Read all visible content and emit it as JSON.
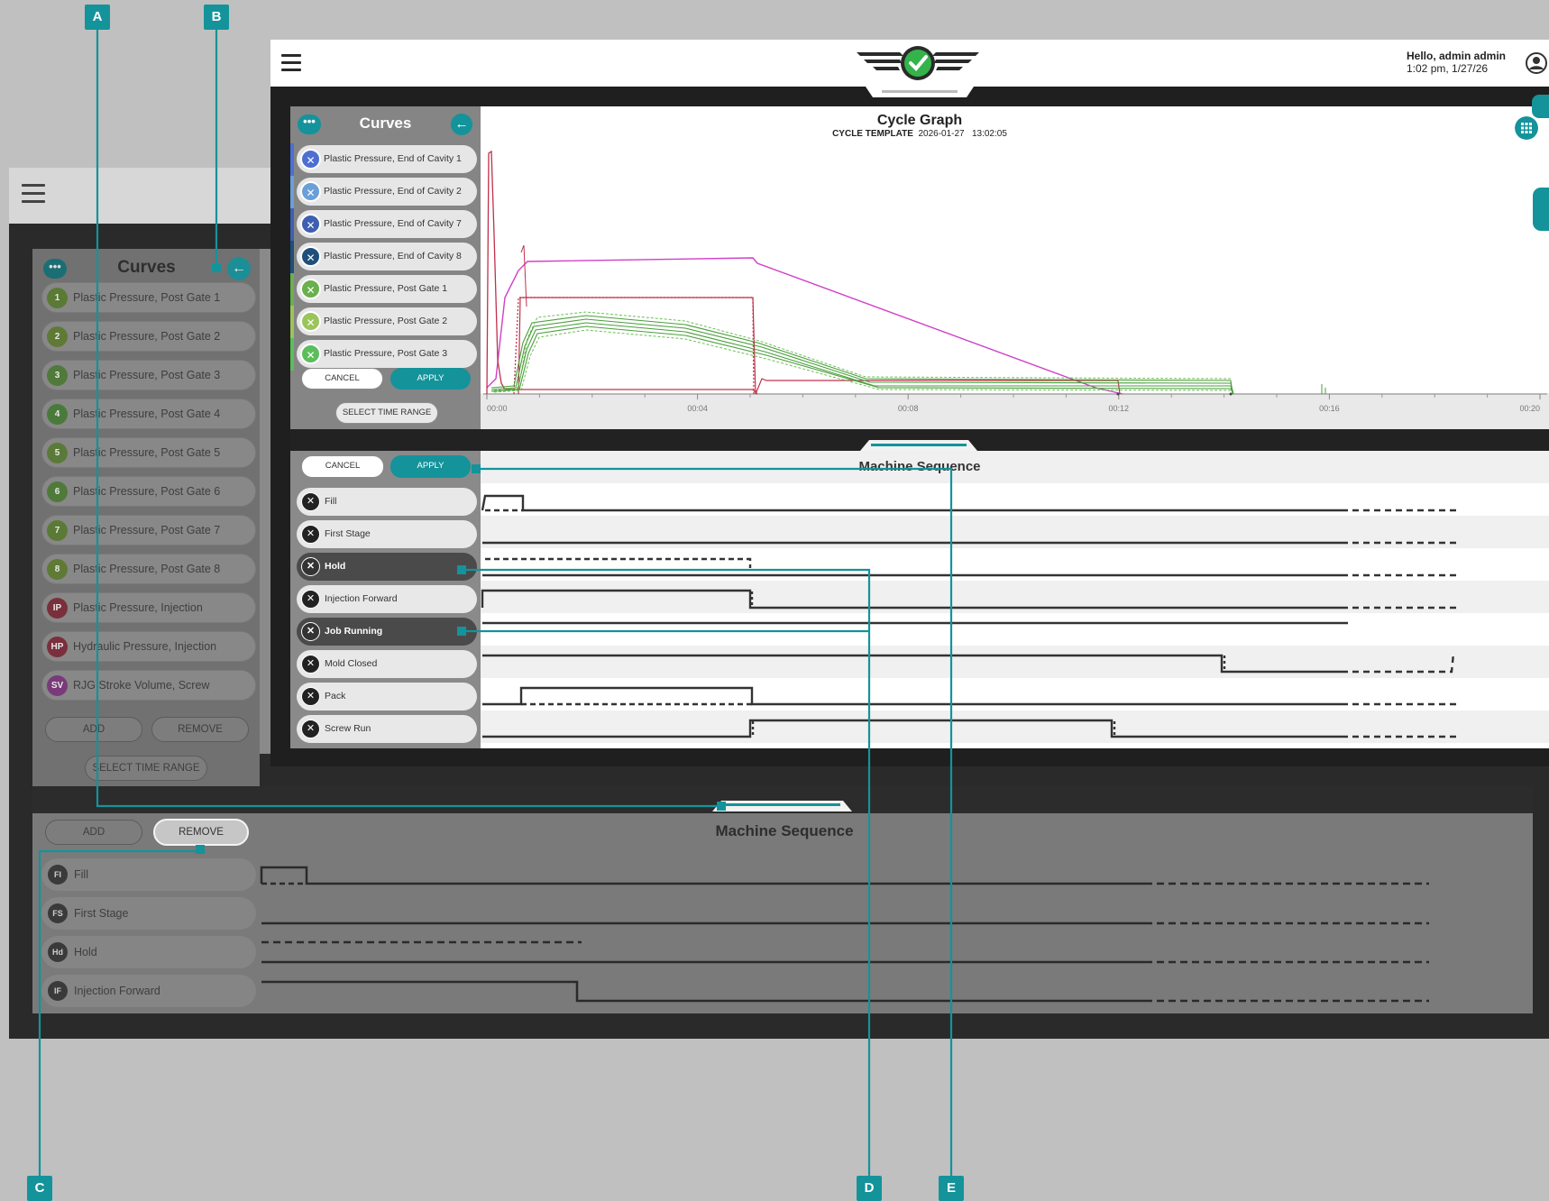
{
  "back_window": {
    "curves_title": "Curves",
    "more_icon": "more-icon",
    "back_icon": "arrow-left-icon",
    "curves": [
      {
        "badge": "1",
        "label": "Plastic Pressure, Post Gate 1",
        "color": "#5a7a35"
      },
      {
        "badge": "2",
        "label": "Plastic Pressure, Post Gate 2",
        "color": "#5f7a35"
      },
      {
        "badge": "3",
        "label": "Plastic Pressure, Post Gate 3",
        "color": "#4f7a3a"
      },
      {
        "badge": "4",
        "label": "Plastic Pressure, Post Gate 4",
        "color": "#4a7a3a"
      },
      {
        "badge": "5",
        "label": "Plastic Pressure, Post Gate 5",
        "color": "#5a7a3a"
      },
      {
        "badge": "6",
        "label": "Plastic Pressure, Post Gate 6",
        "color": "#4f7a3a"
      },
      {
        "badge": "7",
        "label": "Plastic Pressure, Post Gate 7",
        "color": "#5a7a35"
      },
      {
        "badge": "8",
        "label": "Plastic Pressure, Post Gate 8",
        "color": "#5f7a35"
      },
      {
        "badge": "IP",
        "label": "Plastic Pressure, Injection",
        "color": "#7a2f3c"
      },
      {
        "badge": "HP",
        "label": "Hydraulic Pressure, Injection",
        "color": "#7a2f3c"
      },
      {
        "badge": "SV",
        "label": "RJG Stroke Volume, Screw",
        "color": "#7a3a7a"
      }
    ],
    "add_label": "ADD",
    "remove_label": "REMOVE",
    "select_time_range": "SELECT TIME RANGE",
    "seq_title": "Machine Sequence",
    "seq_add": "ADD",
    "seq_remove": "REMOVE",
    "seq_rows": [
      {
        "badge": "FI",
        "label": "Fill"
      },
      {
        "badge": "FS",
        "label": "First Stage"
      },
      {
        "badge": "Hd",
        "label": "Hold"
      },
      {
        "badge": "IF",
        "label": "Injection Forward"
      }
    ]
  },
  "header": {
    "greeting": "Hello, admin admin",
    "datetime": "1:02 pm, 1/27/26",
    "menu_icon": "hamburger-icon",
    "user_icon": "user-icon",
    "logo_icon": "check-wings-logo"
  },
  "curves_panel": {
    "title": "Curves",
    "items": [
      {
        "label": "Plastic Pressure, End of Cavity 1",
        "color": "#4d6fd1"
      },
      {
        "label": "Plastic Pressure, End of Cavity 2",
        "color": "#6a9fd8"
      },
      {
        "label": "Plastic Pressure, End of Cavity 7",
        "color": "#3f5fb0"
      },
      {
        "label": "Plastic Pressure, End of Cavity 8",
        "color": "#1f4f7a"
      },
      {
        "label": "Plastic Pressure, Post Gate 1",
        "color": "#6ab04c"
      },
      {
        "label": "Plastic Pressure, Post Gate 2",
        "color": "#9bc45a"
      },
      {
        "label": "Plastic Pressure, Post Gate 3",
        "color": "#5cbd5c"
      }
    ],
    "cancel": "CANCEL",
    "apply": "APPLY",
    "select_time_range": "SELECT TIME RANGE"
  },
  "chart": {
    "title": "Cycle Graph",
    "template_label": "CYCLE TEMPLATE",
    "date": "2026-01-27",
    "time": "13:02:05",
    "ticks": [
      "00:00",
      "00:04",
      "00:08",
      "00:12",
      "00:16",
      "00:20"
    ]
  },
  "chart_data": {
    "type": "line",
    "title": "Cycle Graph",
    "subtitle": "CYCLE TEMPLATE 2026-01-27 13:02:05",
    "xlim": [
      0,
      20
    ],
    "x_ticks": [
      "00:00",
      "00:04",
      "00:08",
      "00:12",
      "00:16",
      "00:20"
    ],
    "grid": false
  },
  "sequence": {
    "title": "Machine Sequence",
    "cancel": "CANCEL",
    "apply": "APPLY",
    "rows": [
      {
        "label": "Fill",
        "selected": false
      },
      {
        "label": "First Stage",
        "selected": false
      },
      {
        "label": "Hold",
        "selected": true
      },
      {
        "label": "Injection Forward",
        "selected": false
      },
      {
        "label": "Job Running",
        "selected": true
      },
      {
        "label": "Mold Closed",
        "selected": false
      },
      {
        "label": "Pack",
        "selected": false
      },
      {
        "label": "Screw Run",
        "selected": false
      }
    ]
  },
  "callouts": [
    "A",
    "B",
    "C",
    "D",
    "E"
  ],
  "colors": {
    "accent": "#14939b"
  }
}
